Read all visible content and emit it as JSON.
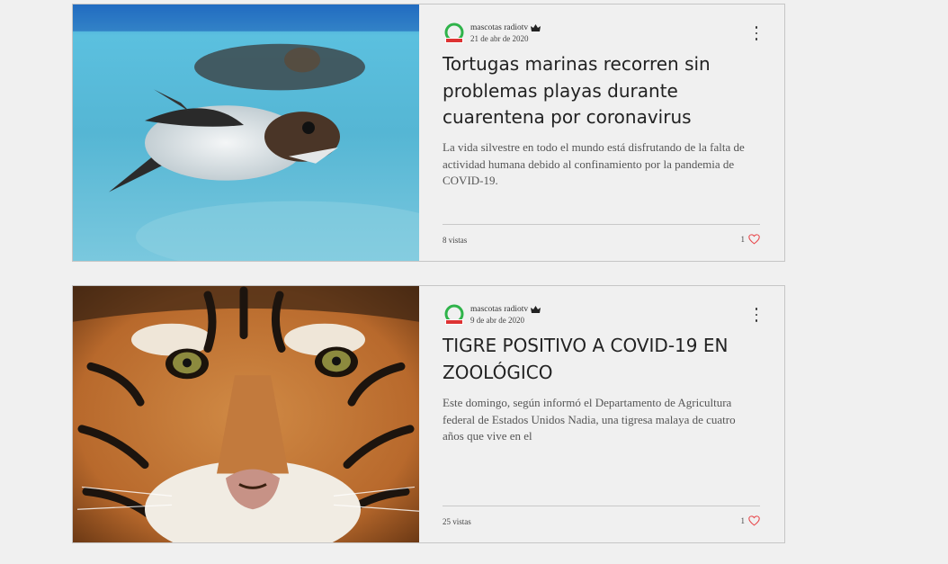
{
  "posts": [
    {
      "author": "mascotas radiotv",
      "date": "21 de abr de 2020",
      "title": "Tortugas marinas recorren sin problemas playas durante cuarentena por coronavirus",
      "excerpt": "La vida silvestre en todo el mundo está disfrutando de la falta de actividad humana debido al confinamiento por la pandemia de COVID-19.",
      "views": "8 vistas",
      "likes": "1",
      "image": "sea-turtle-photo"
    },
    {
      "author": "mascotas radiotv",
      "date": "9 de abr de 2020",
      "title": "TIGRE POSITIVO A COVID-19 EN ZOOLÓGICO",
      "excerpt": "Este domingo, según informó el Departamento de Agricultura federal de Estados Unidos Nadia, una tigresa malaya de cuatro años que vive en el",
      "views": "25 vistas",
      "likes": "1",
      "image": "tiger-photo"
    }
  ],
  "icons": {
    "admin": "crown-icon",
    "menu": "more-vertical-icon",
    "like": "heart-icon"
  },
  "colors": {
    "like": "#e8464a",
    "avatar": "#2fb34a"
  }
}
